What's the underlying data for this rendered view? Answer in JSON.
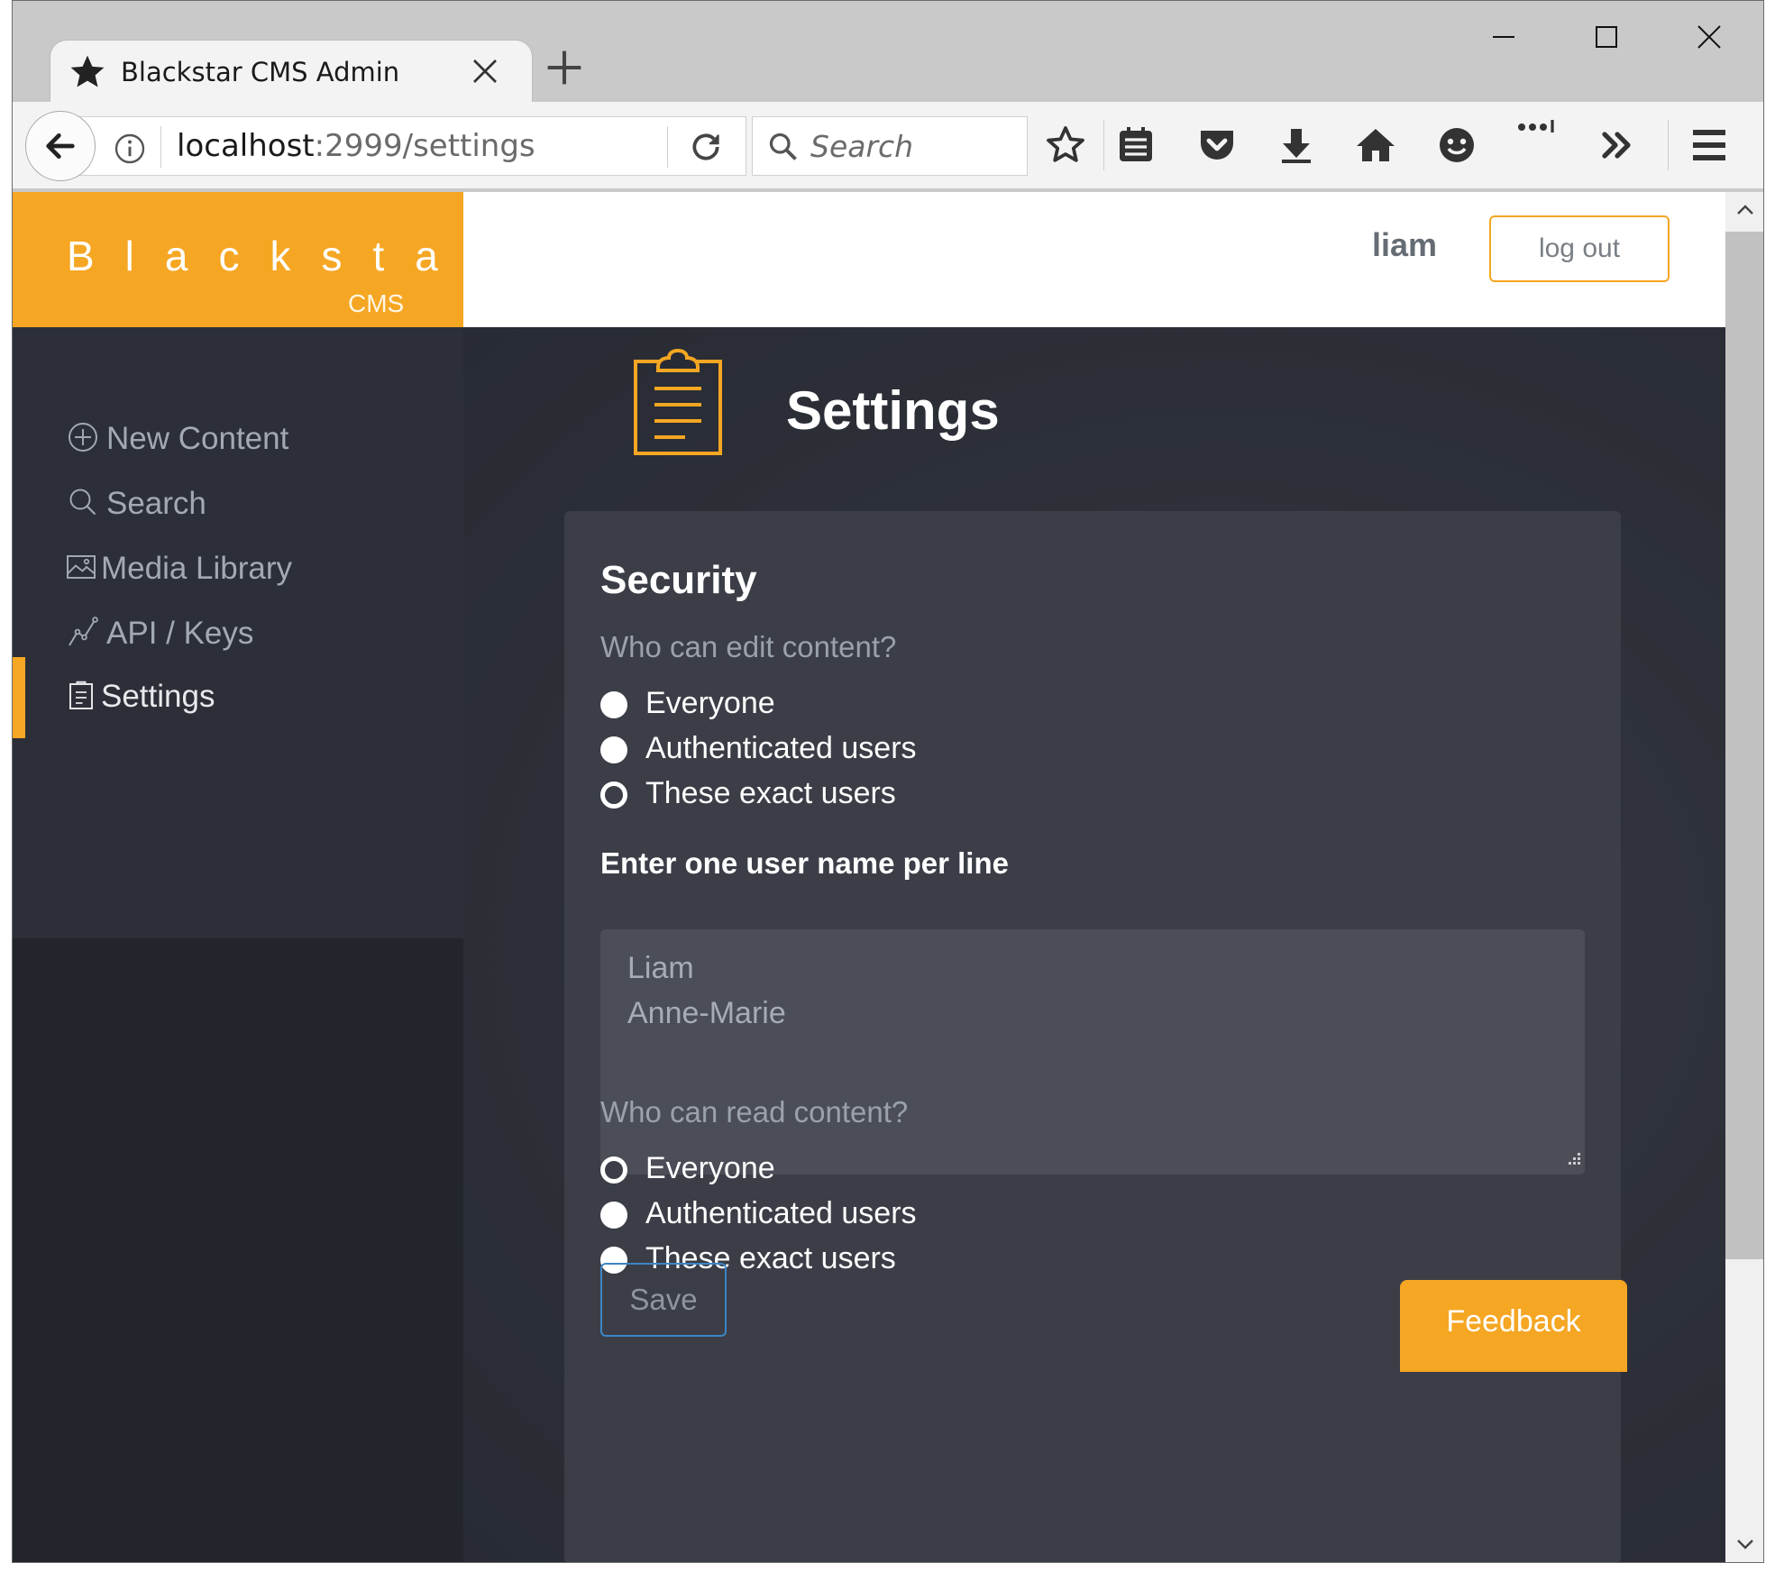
{
  "browser": {
    "tab_title": "Blackstar CMS Admin",
    "url_host": "localhost",
    "url_rest": ":2999/settings",
    "search_placeholder": "Search"
  },
  "app": {
    "brand_name": "Blackstar",
    "brand_sub": "CMS",
    "username": "liam",
    "logout_label": "log out",
    "accent_color": "#f5a623"
  },
  "sidebar": {
    "items": [
      {
        "label": "New Content",
        "icon": "plus-circle-icon"
      },
      {
        "label": "Search",
        "icon": "search-icon"
      },
      {
        "label": "Media Library",
        "icon": "image-icon"
      },
      {
        "label": "API / Keys",
        "icon": "graph-icon"
      },
      {
        "label": "Settings",
        "icon": "clipboard-icon",
        "active": true
      }
    ]
  },
  "page": {
    "title": "Settings",
    "section_title": "Security",
    "edit_question": "Who can edit content?",
    "edit_options": [
      "Everyone",
      "Authenticated users",
      "These exact users"
    ],
    "edit_selected": "These exact users",
    "userlist_label": "Enter one user name per line",
    "userlist_value": "Liam\nAnne-Marie",
    "read_question": "Who can read content?",
    "read_options": [
      "Everyone",
      "Authenticated users",
      "These exact users"
    ],
    "read_selected": "Everyone",
    "save_label": "Save",
    "feedback_label": "Feedback"
  }
}
